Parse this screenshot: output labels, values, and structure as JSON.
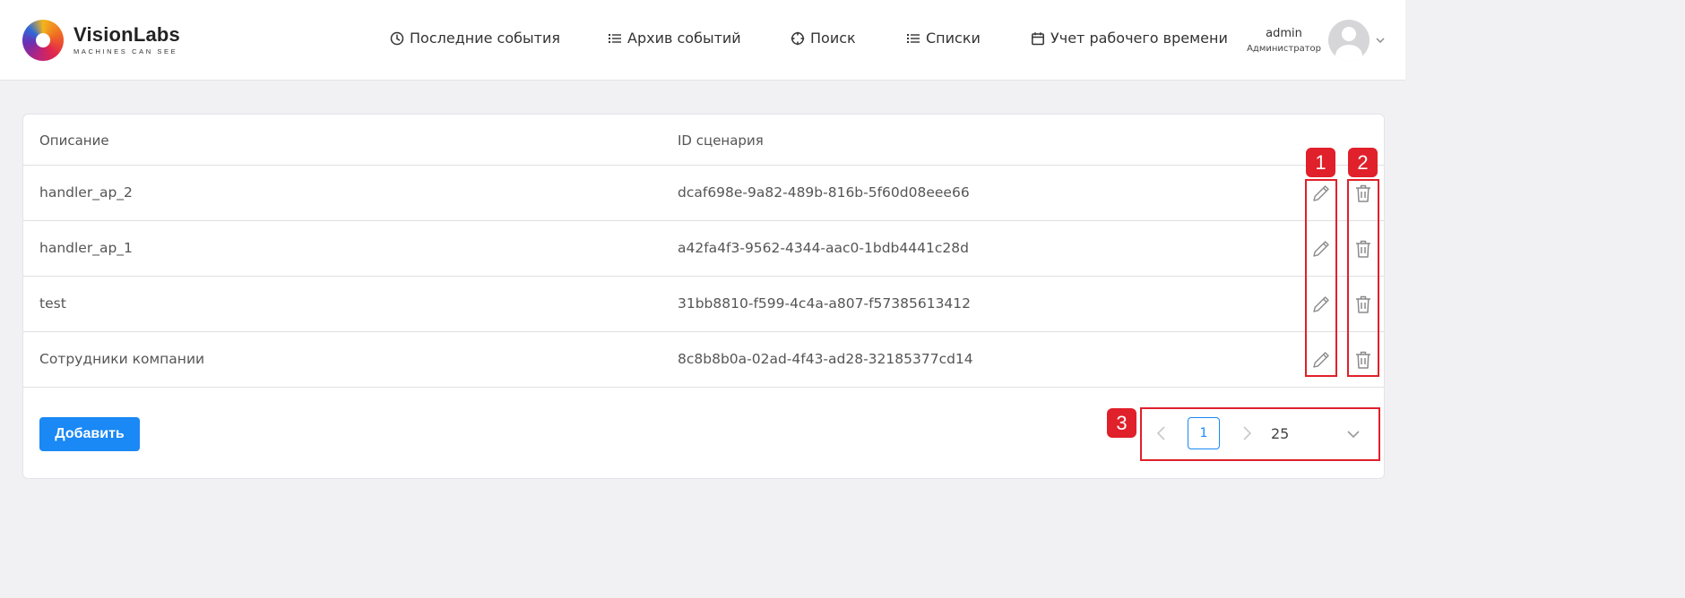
{
  "header": {
    "brand": {
      "name": "VisionLabs",
      "tagline": "MACHINES CAN SEE"
    },
    "nav": [
      {
        "label": "Последние события",
        "icon": "clock-icon"
      },
      {
        "label": "Архив событий",
        "icon": "list-icon"
      },
      {
        "label": "Поиск",
        "icon": "crosshair-icon"
      },
      {
        "label": "Списки",
        "icon": "list-icon"
      },
      {
        "label": "Учет рабочего времени",
        "icon": "calendar-icon"
      }
    ],
    "user": {
      "name": "admin",
      "role": "Администратор"
    }
  },
  "table": {
    "columns": [
      "Описание",
      "ID сценария"
    ],
    "rows": [
      {
        "description": "handler_ap_2",
        "scenario_id": "dcaf698e-9a82-489b-816b-5f60d08eee66"
      },
      {
        "description": "handler_ap_1",
        "scenario_id": "a42fa4f3-9562-4344-aac0-1bdb4441c28d"
      },
      {
        "description": "test",
        "scenario_id": "31bb8810-f599-4c4a-a807-f57385613412"
      },
      {
        "description": "Сотрудники компании",
        "scenario_id": "8c8b8b0a-02ad-4f43-ad28-32185377cd14"
      }
    ]
  },
  "actions": {
    "add_label": "Добавить"
  },
  "pagination": {
    "current_page": "1",
    "page_size": "25"
  },
  "annotations": [
    "1",
    "2",
    "3"
  ],
  "colors": {
    "accent": "#1a88f5",
    "annotation": "#e0202a",
    "background": "#f1f1f3"
  }
}
